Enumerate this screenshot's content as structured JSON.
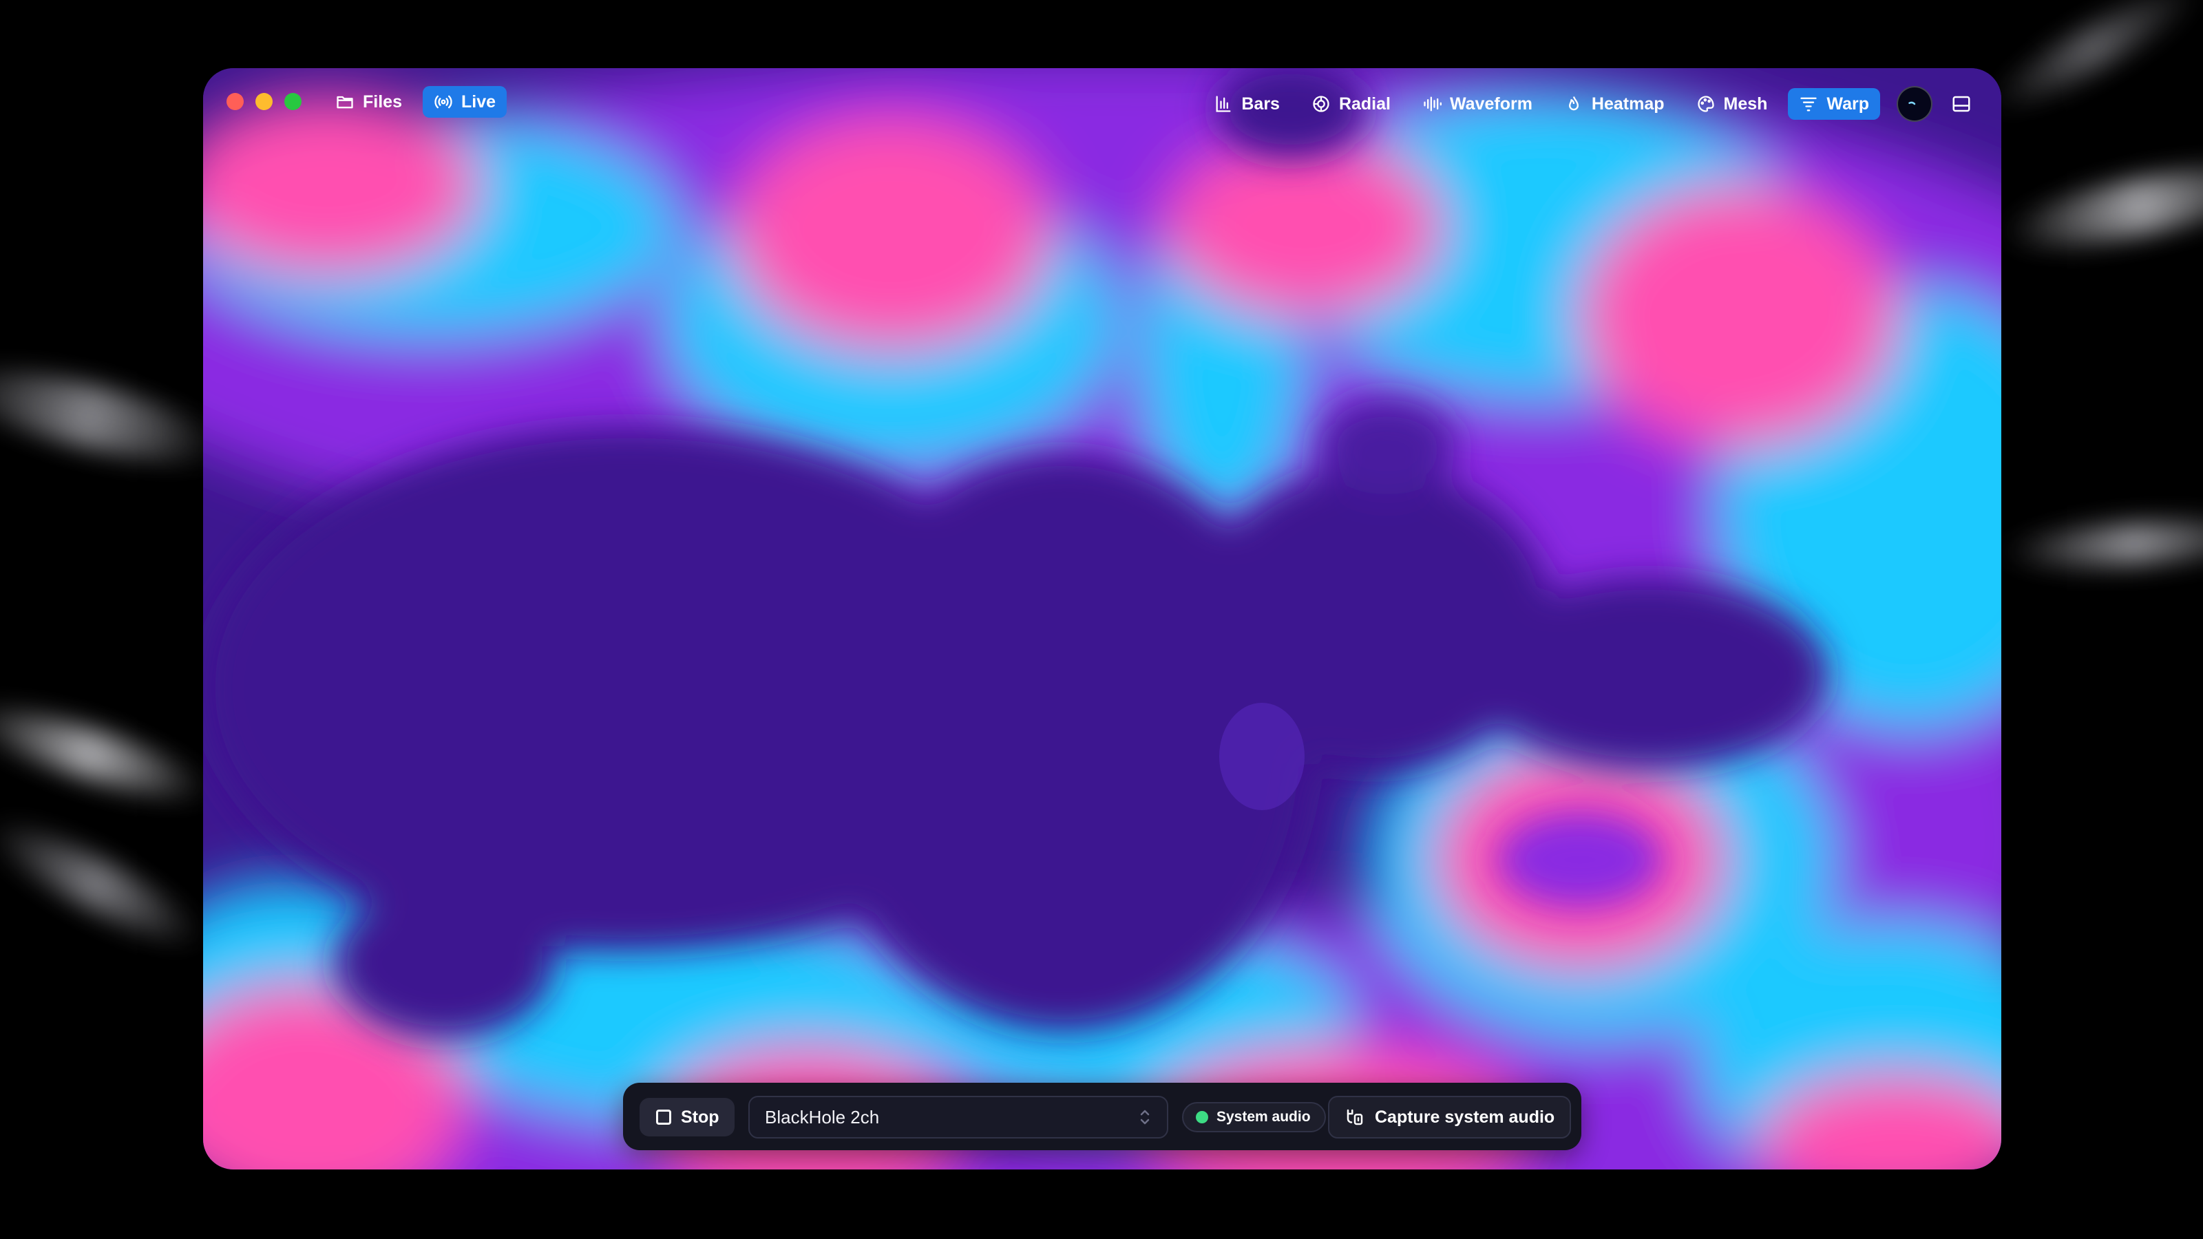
{
  "window": {
    "traffic_lights": [
      "close",
      "minimize",
      "zoom"
    ],
    "nav_left": [
      {
        "label": "Files",
        "icon": "folder-icon",
        "active": false
      },
      {
        "label": "Live",
        "icon": "broadcast-icon",
        "active": true
      }
    ],
    "nav_right": [
      {
        "label": "Bars",
        "icon": "bar-chart-icon",
        "active": false
      },
      {
        "label": "Radial",
        "icon": "radial-icon",
        "active": false
      },
      {
        "label": "Waveform",
        "icon": "waveform-icon",
        "active": false
      },
      {
        "label": "Heatmap",
        "icon": "flame-icon",
        "active": false
      },
      {
        "label": "Mesh",
        "icon": "palette-icon",
        "active": false
      },
      {
        "label": "Warp",
        "icon": "warp-icon",
        "active": true
      }
    ],
    "accent_color": "#1f7ae8",
    "visualization": {
      "mode": "Warp",
      "palette": [
        "#3d1790",
        "#8a2be2",
        "#1ec9ff",
        "#ff4fb0"
      ]
    }
  },
  "controls": {
    "stop_label": "Stop",
    "input_device": "BlackHole 2ch",
    "status_label": "System audio",
    "status_color": "#3ddc84",
    "capture_label": "Capture system audio"
  }
}
